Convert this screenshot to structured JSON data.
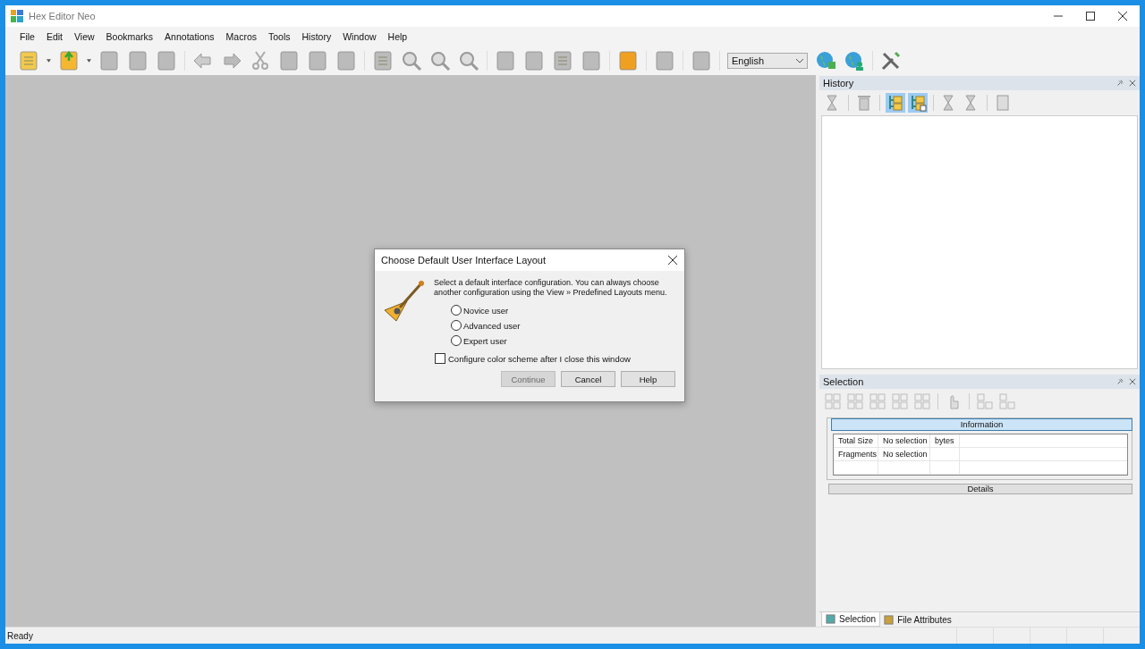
{
  "window": {
    "title": "Hex Editor Neo"
  },
  "menu": [
    "File",
    "Edit",
    "View",
    "Bookmarks",
    "Annotations",
    "Macros",
    "Tools",
    "History",
    "Window",
    "Help"
  ],
  "toolbar": {
    "language": "English"
  },
  "history_panel": {
    "title": "History",
    "tools": [
      {
        "kind": "step",
        "pressed": false
      },
      {
        "kind": "trash",
        "pressed": false
      },
      {
        "kind": "tree",
        "pressed": true
      },
      {
        "kind": "tree-add",
        "pressed": true
      },
      {
        "kind": "step",
        "pressed": false
      },
      {
        "kind": "step",
        "pressed": false
      },
      {
        "kind": "doc",
        "pressed": false
      }
    ]
  },
  "selection_panel": {
    "title": "Selection",
    "information_header": "Information",
    "details_header": "Details",
    "rows": [
      [
        "Total Size",
        "No selection",
        "bytes"
      ],
      [
        "Fragments",
        "No selection",
        ""
      ]
    ]
  },
  "bottom_tabs": [
    {
      "label": "Selection",
      "selected": true
    },
    {
      "label": "File Attributes",
      "selected": false
    }
  ],
  "status_bar": {
    "text": "Ready"
  },
  "dialog": {
    "title": "Choose Default User Interface Layout",
    "message": "Select a default interface configuration. You can always choose another configuration using the View » Predefined Layouts menu.",
    "options": [
      {
        "label": "Novice user",
        "selected": false
      },
      {
        "label": "Advanced user",
        "selected": false
      },
      {
        "label": "Expert user",
        "selected": false
      }
    ],
    "checkbox": {
      "label": "Configure color scheme after I close this window",
      "checked": false
    },
    "buttons": [
      {
        "label": "Continue",
        "disabled": true
      },
      {
        "label": "Cancel",
        "disabled": false
      },
      {
        "label": "Help",
        "disabled": false
      }
    ]
  }
}
